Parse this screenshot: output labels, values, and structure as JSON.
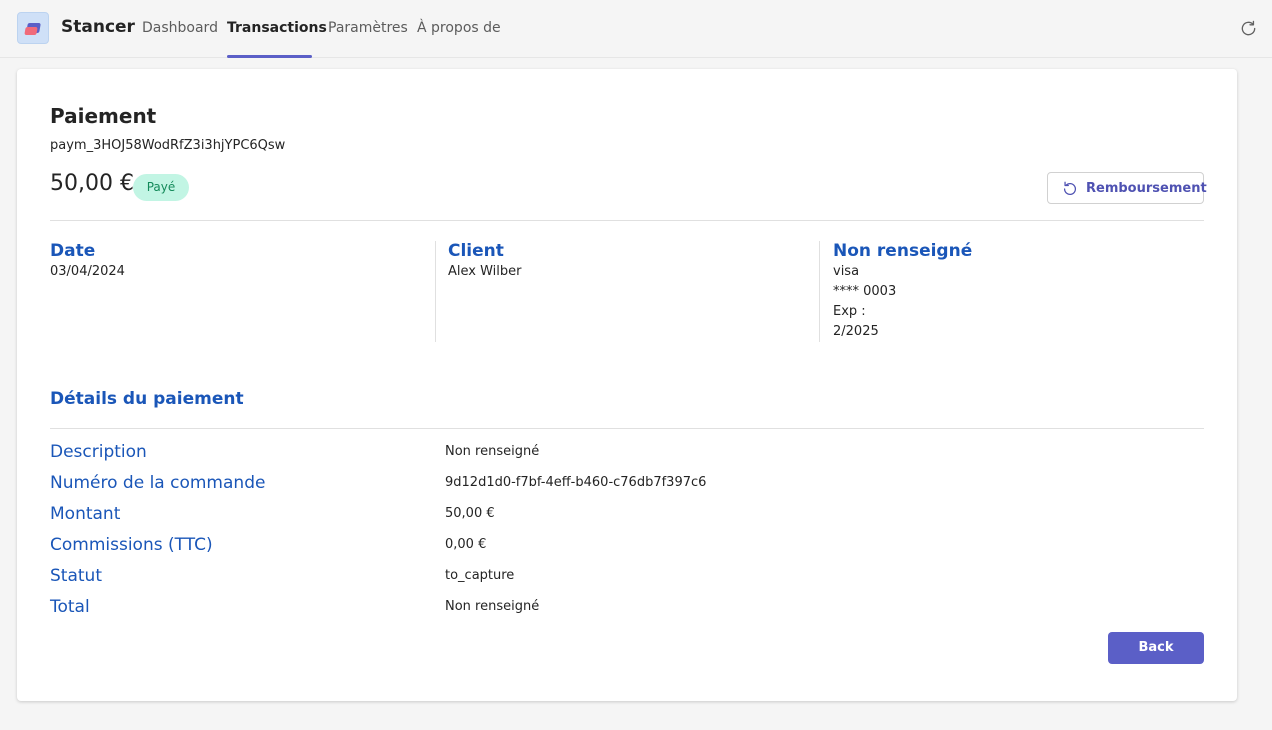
{
  "app": {
    "name": "Stancer"
  },
  "nav": {
    "tabs": [
      {
        "label": "Dashboard"
      },
      {
        "label": "Transactions"
      },
      {
        "label": "Paramètres"
      },
      {
        "label": "À propos de"
      }
    ],
    "active_tab": "Transactions"
  },
  "payment": {
    "title": "Paiement",
    "id": "paym_3HOJ58WodRfZ3i3hjYPC6Qsw",
    "amount": "50,00 €",
    "status": "Payé",
    "refund_label": "Remboursement"
  },
  "info": {
    "date": {
      "title": "Date",
      "value": "03/04/2024"
    },
    "client": {
      "title": "Client",
      "value": "Alex Wilber"
    },
    "card": {
      "title": "Non renseigné",
      "brand": "visa",
      "number": "**** 0003",
      "exp_label": "Exp :",
      "exp_value": "2/2025"
    }
  },
  "details": {
    "title": "Détails du paiement",
    "rows": [
      {
        "label": "Description",
        "value": "Non renseigné"
      },
      {
        "label": "Numéro de la commande",
        "value": "9d12d1d0-f7bf-4eff-b460-c76db7f397c6"
      },
      {
        "label": "Montant",
        "value": "50,00 €"
      },
      {
        "label": "Commissions (TTC)",
        "value": "0,00 €"
      },
      {
        "label": "Statut",
        "value": "to_capture"
      },
      {
        "label": "Total",
        "value": "Non renseigné"
      }
    ]
  },
  "actions": {
    "back_label": "Back"
  },
  "colors": {
    "accent": "#5b5fc7",
    "heading_blue": "#1a56b8",
    "badge_bg": "#c2f5e4",
    "badge_text": "#148a5a"
  },
  "icons": {
    "app_logo": "stancer-logo-icon",
    "refresh": "refresh-icon",
    "refund": "refund-icon"
  }
}
